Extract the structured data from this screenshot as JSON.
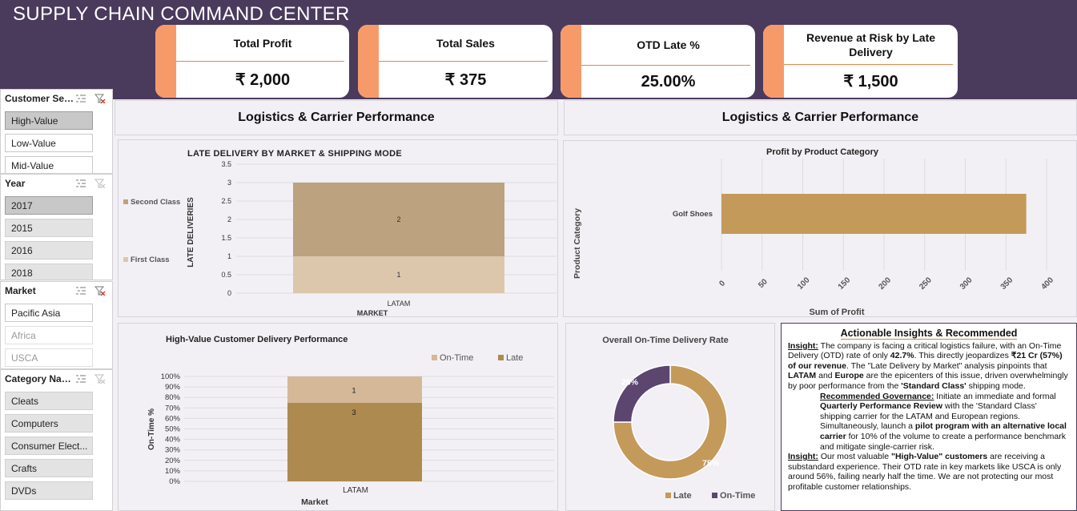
{
  "header": {
    "title": "SUPPLY CHAIN COMMAND CENTER"
  },
  "kpis": [
    {
      "title": "Total Profit",
      "value": "₹ 2,000"
    },
    {
      "title": "Total Sales",
      "value": "₹ 375"
    },
    {
      "title": "OTD Late %",
      "value": "25.00%"
    },
    {
      "title": "Revenue at Risk by Late Delivery",
      "value": "₹ 1,500"
    }
  ],
  "slicers": {
    "customer_segment": {
      "title": "Customer Seg...",
      "items": [
        "High-Value",
        "Low-Value",
        "Mid-Value"
      ]
    },
    "year": {
      "title": "Year",
      "items": [
        "2017",
        "2015",
        "2016",
        "2018"
      ]
    },
    "market": {
      "title": "Market",
      "items": [
        "Pacific Asia",
        "Africa",
        "USCA"
      ]
    },
    "category": {
      "title": "Category Name",
      "items": [
        "Cleats",
        "Computers",
        "Consumer Elect...",
        "Crafts",
        "DVDs"
      ]
    }
  },
  "sections": {
    "left_title": "Logistics & Carrier Performance",
    "right_title": "Logistics & Carrier Performance"
  },
  "colors": {
    "header": "#4a3a5c",
    "accent": "#f79a6a",
    "gold": "#c49a5a",
    "purple": "#5c4670"
  },
  "chart_data": [
    {
      "type": "bar",
      "stacked": true,
      "title": "LATE DELIVERY BY MARKET & SHIPPING MODE",
      "xlabel": "MARKET",
      "ylabel": "LATE DELIVERIES",
      "categories": [
        "LATAM"
      ],
      "series": [
        {
          "name": "First Class",
          "values": [
            1
          ],
          "color": "#dcc7ad"
        },
        {
          "name": "Second Class",
          "values": [
            2
          ],
          "color": "#bca27e"
        }
      ],
      "ylim": [
        0,
        3.5
      ],
      "yticks": [
        "0",
        "0.5",
        "1",
        "1.5",
        "2",
        "2.5",
        "3",
        "3.5"
      ],
      "legend": "left",
      "grid": true
    },
    {
      "type": "bar",
      "orientation": "horizontal",
      "title": "Profit by Product Category",
      "xlabel": "Sum of Profit",
      "ylabel": "Product Category",
      "categories": [
        "Golf Shoes"
      ],
      "values": [
        375
      ],
      "xlim": [
        0,
        400
      ],
      "xticks": [
        "0",
        "50",
        "100",
        "150",
        "200",
        "250",
        "300",
        "350",
        "400"
      ],
      "grid": true
    },
    {
      "type": "bar",
      "stacked": true,
      "percent": true,
      "title": "High-Value Customer Delivery Performance",
      "xlabel": "Market",
      "ylabel": "On-Time %",
      "categories": [
        "LATAM"
      ],
      "series": [
        {
          "name": "Late",
          "values": [
            3
          ],
          "color": "#ad8a4f"
        },
        {
          "name": "On-Time",
          "values": [
            1
          ],
          "color": "#d4b898"
        }
      ],
      "yticks": [
        "0%",
        "10%",
        "20%",
        "30%",
        "40%",
        "50%",
        "60%",
        "70%",
        "80%",
        "90%",
        "100%"
      ],
      "legend": "top-right",
      "legend_order": [
        "On-Time",
        "Late"
      ],
      "grid": true
    },
    {
      "type": "pie",
      "donut": true,
      "title": "Overall On-Time Delivery Rate",
      "series": [
        {
          "name": "Late",
          "value": 75,
          "label": "75%",
          "color": "#c49a5a"
        },
        {
          "name": "On-Time",
          "value": 25,
          "label": "25%",
          "color": "#5c4670"
        }
      ],
      "legend": "bottom"
    }
  ],
  "insights": {
    "title": "Actionable Insights & Recommended",
    "p1_label": "Insight:",
    "p1_a": " The company is facing a critical logistics failure, with an On-Time Delivery (OTD) rate of only ",
    "p1_b": "42.7%",
    "p1_c": ". This directly jeopardizes ",
    "p1_d": "₹21 Cr (57%) of our revenue",
    "p1_e": ". The \"Late Delivery by Market\" analysis pinpoints that ",
    "p1_f": "LATAM",
    "p1_g": " and ",
    "p1_h": "Europe",
    "p1_i": " are the epicenters of this issue, driven overwhelmingly by poor performance from the ",
    "p1_j": "'Standard Class'",
    "p1_k": " shipping mode.",
    "p2_label": "Recommended Governance:",
    "p2_a": " Initiate an immediate and formal ",
    "p2_b": "Quarterly Performance Review",
    "p2_c": " with the 'Standard Class' shipping carrier for the LATAM and European regions. Simultaneously, launch a ",
    "p2_d": "pilot program with an alternative local carrier",
    "p2_e": " for 10% of the volume to create a performance benchmark and mitigate single-carrier risk.",
    "p3_label": "Insight:",
    "p3_a": " Our most valuable ",
    "p3_b": "\"High-Value\" customers",
    "p3_c": " are receiving a substandard experience. Their OTD rate in key markets like USCA is only around 56%, failing nearly half the time. We are not protecting our most profitable customer relationships."
  }
}
